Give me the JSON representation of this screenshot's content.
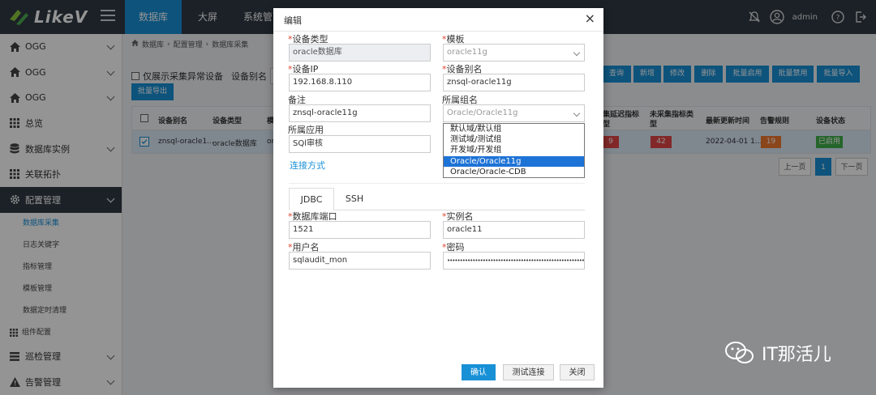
{
  "app": {
    "logo": "LikeV",
    "brand_color": "#1890d6"
  },
  "topnav": {
    "tabs": [
      "数据库",
      "大屏",
      "系统管"
    ],
    "user": "admin"
  },
  "sidebar": {
    "items": [
      {
        "label": "OGG",
        "icon": "home-icon"
      },
      {
        "label": "OGG",
        "icon": "home-icon"
      },
      {
        "label": "OGG",
        "icon": "home-icon"
      },
      {
        "label": "总览",
        "icon": "grid-icon"
      },
      {
        "label": "数据库实例",
        "icon": "database-icon"
      },
      {
        "label": "关联拓扑",
        "icon": "grid-icon"
      },
      {
        "label": "配置管理",
        "icon": "gear-icon"
      }
    ],
    "sub_items": [
      "数据库采集",
      "日志关键字",
      "指标管理",
      "模板管理",
      "数据定时清理"
    ],
    "group_config": "组件配置",
    "bottom_items": [
      {
        "label": "巡检管理",
        "icon": "list-icon"
      },
      {
        "label": "告警管理",
        "icon": "warning-icon"
      }
    ]
  },
  "breadcrumb": [
    "数据库",
    "配置管理",
    "数据库采集"
  ],
  "toolbar": {
    "show_abnormal": "仅展示采集异常设备",
    "alias_label": "设备别名",
    "export": "批量导出",
    "buttons": [
      "查询",
      "新增",
      "修改",
      "删除",
      "批量启用",
      "批量禁用",
      "批量导入"
    ]
  },
  "table": {
    "headers": [
      "设备别名",
      "设备类型",
      "模",
      "集延迟指标型",
      "未采集指标类型",
      "最新更新时间",
      "告警规则",
      "设备状态"
    ],
    "row": {
      "alias": "znsql-oracle1...",
      "type": "oracle数据库",
      "tpl": "or",
      "delay": "9",
      "uncollected": "42",
      "updated": "2022-04-01 1...",
      "alarm": "19",
      "status": "已启用"
    }
  },
  "pager": {
    "prev": "上一页",
    "page": "1",
    "next": "下一页"
  },
  "modal": {
    "title": "编辑",
    "device_type_label": "设备类型",
    "device_type_value": "oracle数据库",
    "template_label": "模板",
    "template_value": "oracle11g",
    "ip_label": "设备IP",
    "ip_value": "192.168.8.110",
    "alias_label": "设备别名",
    "alias_value": "znsql-oracle11g",
    "remark_label": "备注",
    "remark_value": "znsql-oracle11g",
    "group_label": "所属组名",
    "group_value": "Oracle/Oracle11g",
    "app_label": "所属应用",
    "app_value": "SQl审核",
    "connect_link": "连接方式",
    "group_options": [
      "默认域/默认组",
      "测试域/测试组",
      "开发域/开发组",
      "Oracle/Oracle11g",
      "Oracle/Oracle-CDB"
    ],
    "tabs": [
      "JDBC",
      "SSH"
    ],
    "port_label": "数据库端口",
    "port_value": "1521",
    "instance_label": "实例名",
    "instance_value": "oracle11",
    "user_label": "用户名",
    "user_value": "sqlaudit_mon",
    "password_label": "密码",
    "password_value": "••••••••••••••••••••••••••••••••••••••••••••••••••••••",
    "confirm": "确认",
    "test": "测试连接",
    "close": "关闭"
  },
  "watermark": "IT那活儿"
}
